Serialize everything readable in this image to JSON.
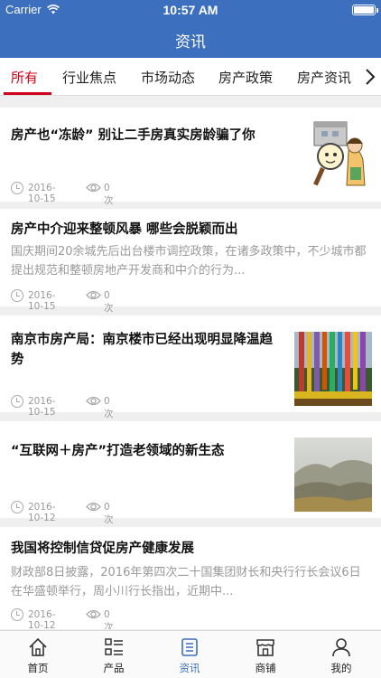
{
  "status_bar": {
    "carrier": "Carrier",
    "time": "10:57 AM"
  },
  "header": {
    "title": "资讯"
  },
  "tabs": [
    {
      "label": "所有",
      "active": true
    },
    {
      "label": "行业焦点",
      "active": false
    },
    {
      "label": "市场动态",
      "active": false
    },
    {
      "label": "房产政策",
      "active": false
    },
    {
      "label": "房产资讯",
      "active": false
    }
  ],
  "articles": [
    {
      "title": "房产也“冻龄” 别让二手房真实房龄骗了你",
      "summary": "",
      "date": "2016-10-15",
      "views": "0次",
      "thumbnail": "cartoon-magnifier"
    },
    {
      "title": "房产中介迎来整顿风暴 哪些会脱颖而出",
      "summary": "国庆期间20余城先后出台楼市调控政策，在诸多政策中，不少城市都提出规范和整顿房地产开发商和中介的行为...",
      "date": "2016-10-15",
      "views": "0次",
      "thumbnail": ""
    },
    {
      "title": "南京市房产局：南京楼市已经出现明显降温趋势",
      "summary": "",
      "date": "2016-10-15",
      "views": "0次",
      "thumbnail": "colorful-poles"
    },
    {
      "title": "“互联网＋房产”打造老领域的新生态",
      "summary": "",
      "date": "2016-10-12",
      "views": "0次",
      "thumbnail": "misty-landscape"
    },
    {
      "title": "我国将控制信贷促房产健康发展",
      "summary": "财政部8日披露，2016年第四次二十国集团财长和央行行长会议6日在华盛顿举行，周小川行长指出，近期中...",
      "date": "2016-10-12",
      "views": "0次",
      "thumbnail": ""
    }
  ],
  "bottom_nav": [
    {
      "label": "首页",
      "icon": "home-icon",
      "active": false
    },
    {
      "label": "产品",
      "icon": "list-icon",
      "active": false
    },
    {
      "label": "资讯",
      "icon": "news-icon",
      "active": true
    },
    {
      "label": "商铺",
      "icon": "store-icon",
      "active": false
    },
    {
      "label": "我的",
      "icon": "user-icon",
      "active": false
    }
  ],
  "colors": {
    "header": "#3d6fbf",
    "tab_active": "#d0021b",
    "nav_active": "#3d6fbf",
    "muted_text": "#999999"
  }
}
